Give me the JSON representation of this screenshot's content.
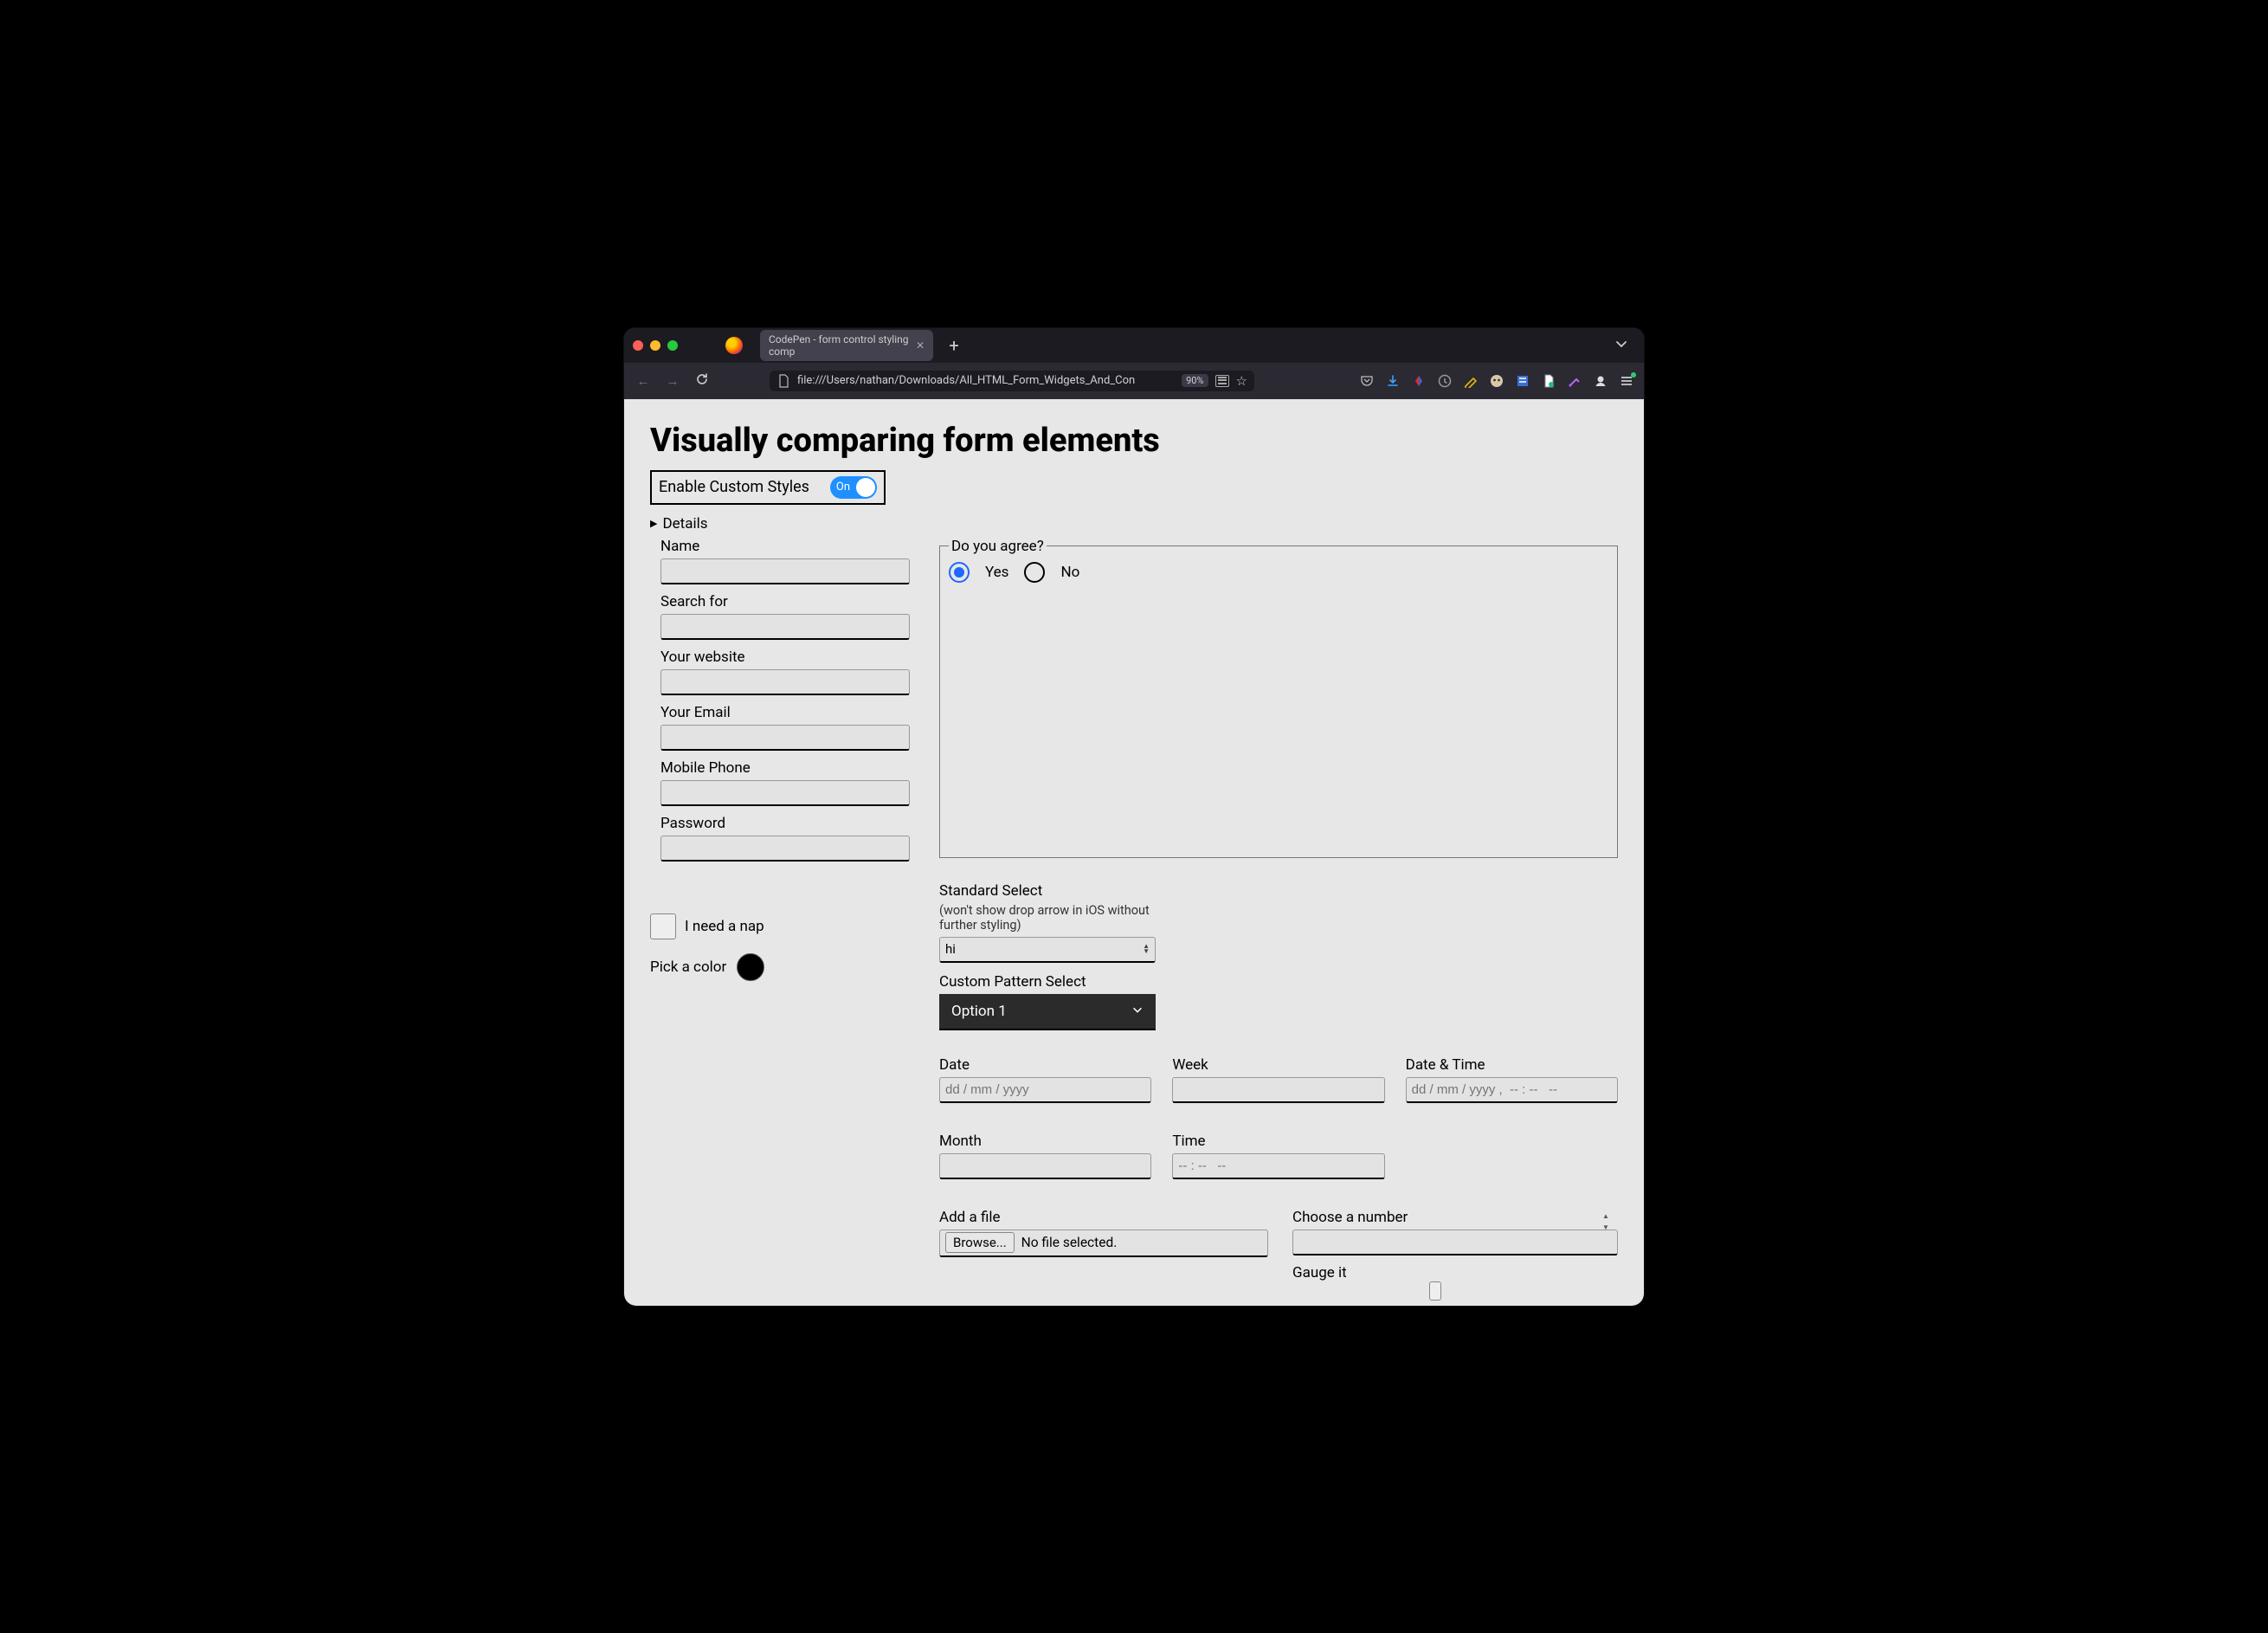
{
  "browser": {
    "tab_title": "CodePen - form control styling comp",
    "url": "file:///Users/nathan/Downloads/All_HTML_Form_Widgets_And_Con",
    "zoom": "90%"
  },
  "page": {
    "heading": "Visually comparing form elements",
    "toggle_label": "Enable Custom Styles",
    "toggle_state": "On",
    "details_label": "Details"
  },
  "left_fields": {
    "name": "Name",
    "search": "Search for",
    "website": "Your website",
    "email": "Your Email",
    "phone": "Mobile Phone",
    "password": "Password"
  },
  "agree": {
    "legend": "Do you agree?",
    "yes": "Yes",
    "no": "No"
  },
  "mid": {
    "nap": "I need a nap",
    "pick_color": "Pick a color"
  },
  "selects": {
    "standard_label": "Standard Select",
    "standard_note": "(won't show drop arrow in iOS without further styling)",
    "standard_value": "hi",
    "custom_label": "Custom Pattern Select",
    "custom_value": "Option 1"
  },
  "dates": {
    "date": "Date",
    "date_ph": "dd / mm / yyyy",
    "week": "Week",
    "datetime": "Date & Time",
    "datetime_ph": "dd / mm / yyyy ,  -- : --   --",
    "month": "Month",
    "time": "Time",
    "time_ph": "-- : --   --"
  },
  "bottom": {
    "file_label": "Add a file",
    "browse": "Browse...",
    "no_file": "No file selected.",
    "number_label": "Choose a number",
    "gauge_label": "Gauge it"
  }
}
